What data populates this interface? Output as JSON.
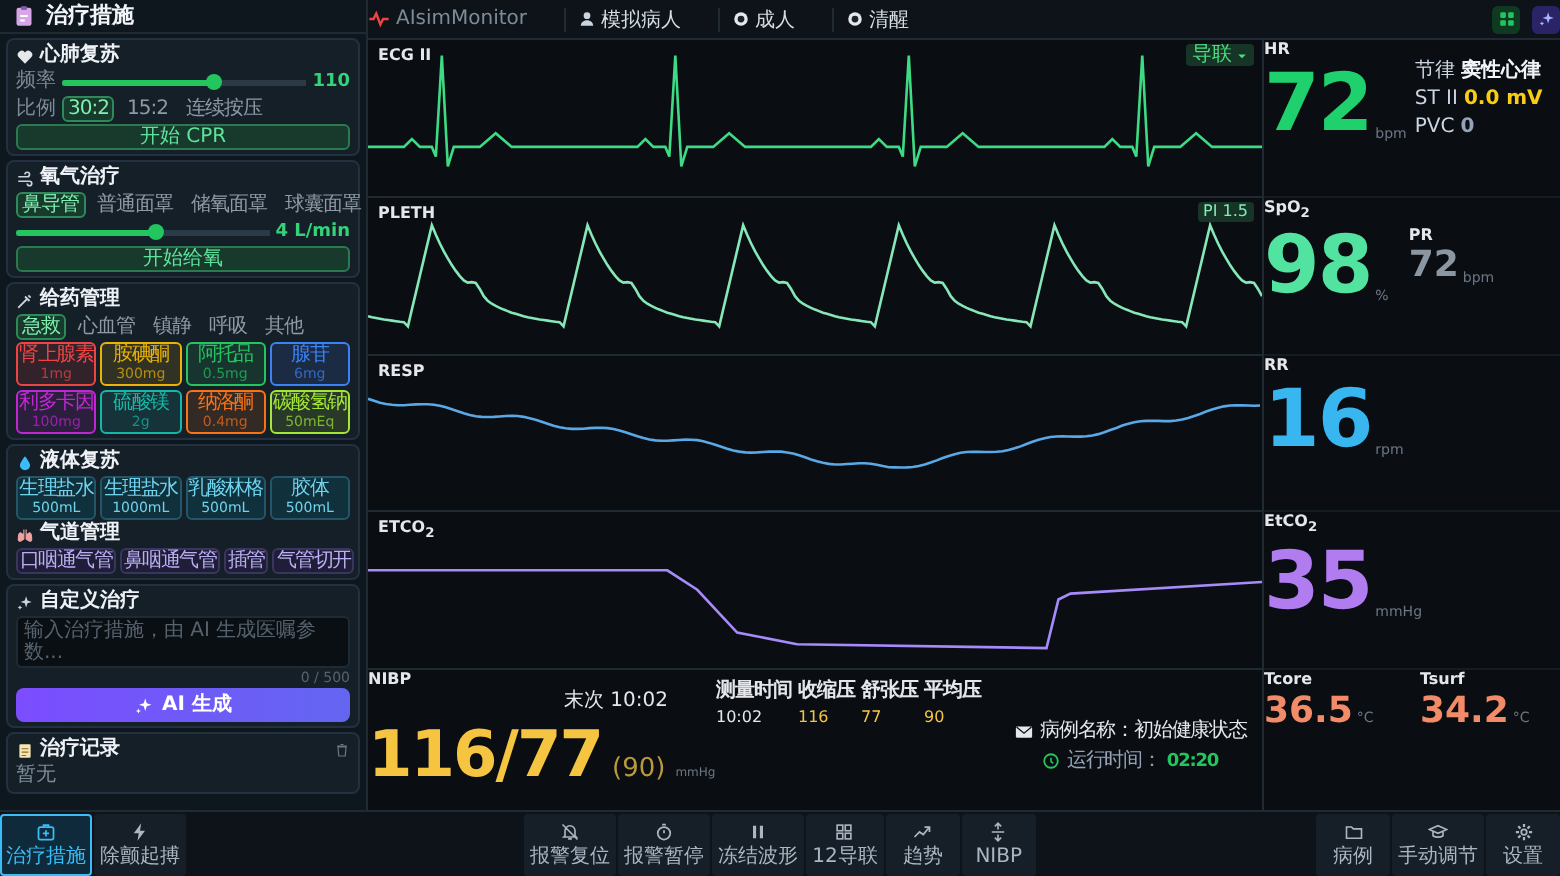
{
  "treatment_panel": {
    "title": "治疗措施",
    "cpr": {
      "title": "心肺复苏",
      "rate_label": "频率",
      "rate": {
        "level": 0.62,
        "reading": "110"
      },
      "ratio_label": "比例",
      "ratios": [
        {
          "label": "30:2",
          "selected": true
        },
        {
          "label": "15:2",
          "selected": false
        },
        {
          "label": "连续按压",
          "selected": false
        }
      ],
      "button": "开始 CPR"
    },
    "oxygen": {
      "title": "氧气治疗",
      "modes": [
        {
          "label": "鼻导管",
          "selected": true
        },
        {
          "label": "普通面罩",
          "selected": false
        },
        {
          "label": "储氧面罩",
          "selected": false
        },
        {
          "label": "球囊面罩",
          "selected": false
        }
      ],
      "flow": {
        "level": 0.55,
        "reading": "4 L/min"
      },
      "button": "开始给氧"
    },
    "medication": {
      "title": "给药管理",
      "categories": [
        {
          "label": "急救",
          "selected": true
        },
        {
          "label": "心血管",
          "selected": false
        },
        {
          "label": "镇静",
          "selected": false
        },
        {
          "label": "呼吸",
          "selected": false
        },
        {
          "label": "其他",
          "selected": false
        }
      ],
      "drugs": [
        {
          "name": "肾上腺素",
          "dose": "1mg",
          "color": "#ef4444"
        },
        {
          "name": "胺碘酮",
          "dose": "300mg",
          "color": "#eab308"
        },
        {
          "name": "阿托品",
          "dose": "0.5mg",
          "color": "#22c55e"
        },
        {
          "name": "腺苷",
          "dose": "6mg",
          "color": "#3b82f6"
        },
        {
          "name": "利多卡因",
          "dose": "100mg",
          "color": "#c026d3"
        },
        {
          "name": "硫酸镁",
          "dose": "2g",
          "color": "#14b8a6"
        },
        {
          "name": "纳洛酮",
          "dose": "0.4mg",
          "color": "#f97316"
        },
        {
          "name": "碳酸氢钠",
          "dose": "50mEq",
          "color": "#a3e635"
        }
      ]
    },
    "fluids": {
      "title": "液体复苏",
      "items": [
        {
          "name": "生理盐水",
          "volume": "500mL"
        },
        {
          "name": "生理盐水",
          "volume": "1000mL"
        },
        {
          "name": "乳酸林格",
          "volume": "500mL"
        },
        {
          "name": "胶体",
          "volume": "500mL"
        }
      ]
    },
    "airway": {
      "title": "气道管理",
      "items": [
        "口咽通气管",
        "鼻咽通气管",
        "插管",
        "气管切开"
      ]
    },
    "custom": {
      "title": "自定义治疗",
      "placeholder": "输入治疗措施，由 AI 生成医嘱参数...",
      "counter": "0 / 500",
      "button": "AI 生成"
    },
    "records": {
      "title": "治疗记录",
      "empty": "暂无"
    }
  },
  "top_bar": {
    "app_name": "AIsimMonitor",
    "patient": "模拟病人",
    "age_group": "成人",
    "consciousness": "清醒"
  },
  "waveforms": [
    {
      "label": "ECG II",
      "kind": "ecg",
      "color": "#3ddc84",
      "dropdown": "导联"
    },
    {
      "label": "PLETH",
      "kind": "pleth",
      "color": "#86e8b8",
      "badge": "PI 1.5"
    },
    {
      "label": "RESP",
      "kind": "resp",
      "color": "#5aa9e6"
    },
    {
      "label": "ETCO$_{2}$",
      "kind": "co2",
      "color": "#a78bfa"
    }
  ],
  "nibp": {
    "label": "NIBP",
    "last_measured": "末次 10:02",
    "value": "116/77",
    "mean": "(90)",
    "unit": "mmHg",
    "table": {
      "columns": [
        "测量时间",
        "收缩压",
        "舒张压",
        "平均压"
      ],
      "rows": [
        [
          "10:02",
          "116",
          "77",
          "90"
        ]
      ]
    },
    "case": "病例名称：初始健康状态",
    "runtime_label": "运行时间：",
    "runtime": "02:20"
  },
  "vitals": [
    {
      "label": "HR",
      "value": "72",
      "unit": "bpm",
      "color": "#1fd16c",
      "details": [
        {
          "label": "节律",
          "value": "窦性心律",
          "color": "#f1f5f9"
        },
        {
          "label": "ST II",
          "value": "0.0 mV",
          "color": "#facc15"
        },
        {
          "label": "PVC",
          "value": "0",
          "color": "#94a3b8"
        }
      ]
    },
    {
      "label": "SpO$_{2}$",
      "value": "98",
      "unit": "%",
      "color": "#52e3a0",
      "secondary": {
        "label": "PR",
        "value": "72",
        "unit": "bpm"
      }
    },
    {
      "label": "RR",
      "value": "16",
      "unit": "rpm",
      "color": "#38b6f0"
    },
    {
      "label": "EtCO$_{2}$",
      "value": "35",
      "unit": "mmHg",
      "color": "#b07cf0"
    }
  ],
  "temperatures": [
    {
      "label": "Tcore",
      "value": "36.5",
      "unit": "°C",
      "color": "#f28b68"
    },
    {
      "label": "Tsurf",
      "value": "34.2",
      "unit": "°C",
      "color": "#f28b68"
    }
  ],
  "bottom_bar": {
    "left": [
      {
        "label": "治疗措施",
        "selected": true
      },
      {
        "label": "除颤起搏",
        "selected": false
      }
    ],
    "center": [
      "报警复位",
      "报警暂停",
      "冻结波形",
      "12导联",
      "趋势",
      "NIBP"
    ],
    "right": [
      "病例",
      "手动调节",
      "设置"
    ]
  }
}
